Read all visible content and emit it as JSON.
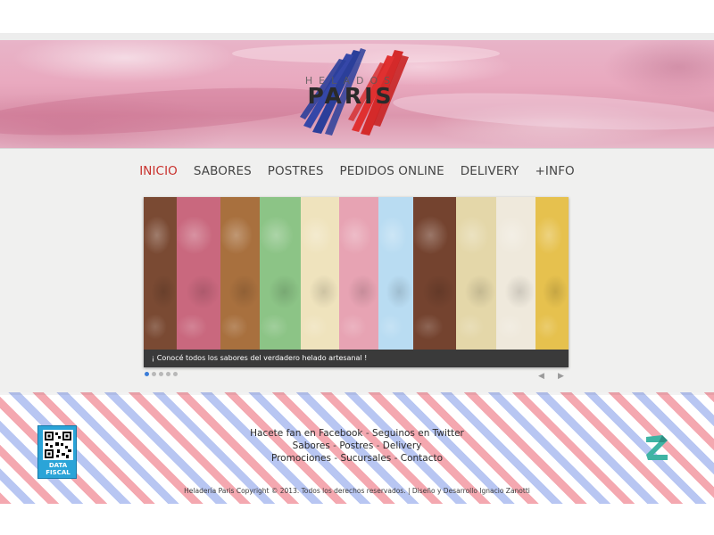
{
  "brand": {
    "logo_small": "HELADOS",
    "logo_big": "PARIS",
    "colors": {
      "blue": "#2b3f9a",
      "red": "#d42a2a",
      "dark": "#2a2a2a"
    }
  },
  "nav": {
    "items": [
      {
        "label": "INICIO",
        "active": true
      },
      {
        "label": "SABORES"
      },
      {
        "label": "POSTRES"
      },
      {
        "label": "PEDIDOS ONLINE"
      },
      {
        "label": "DELIVERY"
      },
      {
        "label": "+INFO"
      }
    ],
    "active_color": "#c9302c"
  },
  "slider": {
    "caption": "¡ Conocé todos los sabores del verdadero helado artesanal !",
    "current_slide": 1,
    "slide_count": 5,
    "flavor_colors": [
      "#7a4a33",
      "#c9687e",
      "#a8703e",
      "#8cc486",
      "#efe3bd",
      "#e7a3b3",
      "#b9dcf2",
      "#74432f",
      "#e4d7a9",
      "#efe9dc",
      "#e6c14e"
    ]
  },
  "footer": {
    "row1": [
      "Hacete fan en Facebook",
      "Seguinos en Twitter"
    ],
    "row2": [
      "Sabores",
      "Postres",
      "Delivery"
    ],
    "row3": [
      "Promociones",
      "Sucursales",
      "Contacto"
    ],
    "separator": "-",
    "copyright": "Heladería Paris Copyright © 2013. Todos los derechos reservados. | Diseño y Desarrollo Ignacio Zanotti",
    "data_fiscal_label_1": "DATA",
    "data_fiscal_label_2": "FISCAL"
  }
}
